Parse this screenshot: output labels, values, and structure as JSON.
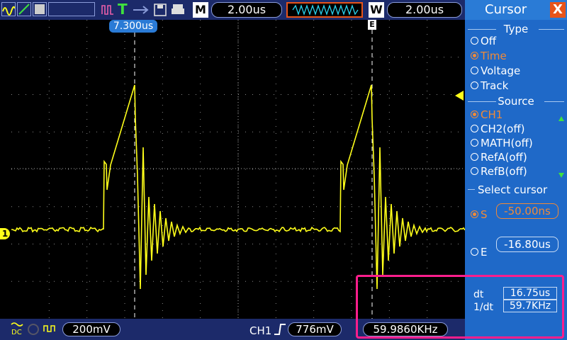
{
  "toolbar": {
    "timebase_main": "2.00us",
    "timebase_window": "2.00us",
    "m_label": "M",
    "w_label": "W",
    "trigger_mode": "T"
  },
  "scope": {
    "cursor_marker": "7.300us",
    "channel_marker": "1",
    "trigger_marker": "E"
  },
  "bottom": {
    "ch1_scale": "200mV",
    "trigger_channel": "CH1",
    "trigger_level": "776mV",
    "frequency": "59.9860KHz"
  },
  "panel": {
    "title": "Cursor",
    "close": "X",
    "type_heading": "Type",
    "type_options": [
      "Off",
      "Time",
      "Voltage",
      "Track"
    ],
    "type_selected": "Time",
    "source_heading": "Source",
    "source_options": [
      "CH1",
      "CH2(off)",
      "MATH(off)",
      "RefA(off)",
      "RefB(off)"
    ],
    "source_selected": "CH1",
    "select_heading": "Select cursor",
    "s_label": "S",
    "s_value": "-50.00ns",
    "e_label": "E",
    "e_value": "-16.80us",
    "dt_label": "dt",
    "dt_value": "16.75us",
    "inv_dt_label": "1/dt",
    "inv_dt_value": "59.7KHz"
  },
  "colors": {
    "trace": "#ffff1a",
    "panel_bg": "#1f69c8",
    "selected": "#f08a38",
    "highlight": "#ff1e8c"
  }
}
